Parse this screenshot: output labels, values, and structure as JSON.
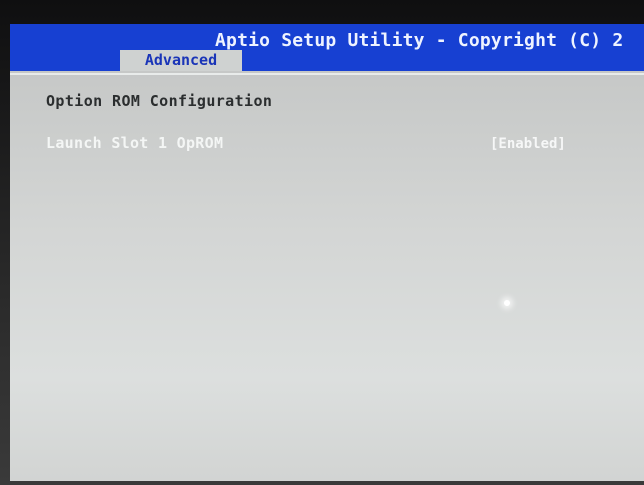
{
  "bios": {
    "title": "Aptio Setup Utility - Copyright (C) 2",
    "active_tab": "Advanced"
  },
  "page": {
    "section_title": "Option ROM Configuration",
    "options": [
      {
        "label": "Launch Slot 1 OpROM",
        "value": "[Enabled]"
      }
    ]
  },
  "colors": {
    "title_bar": "#1740d2",
    "title_text": "#eef3ff",
    "tab_background": "#cfd2d1",
    "tab_text": "#1a35b8",
    "panel_background": "#c9cbca",
    "section_text": "#2b2e2f",
    "option_text": "#f4f6f5"
  }
}
